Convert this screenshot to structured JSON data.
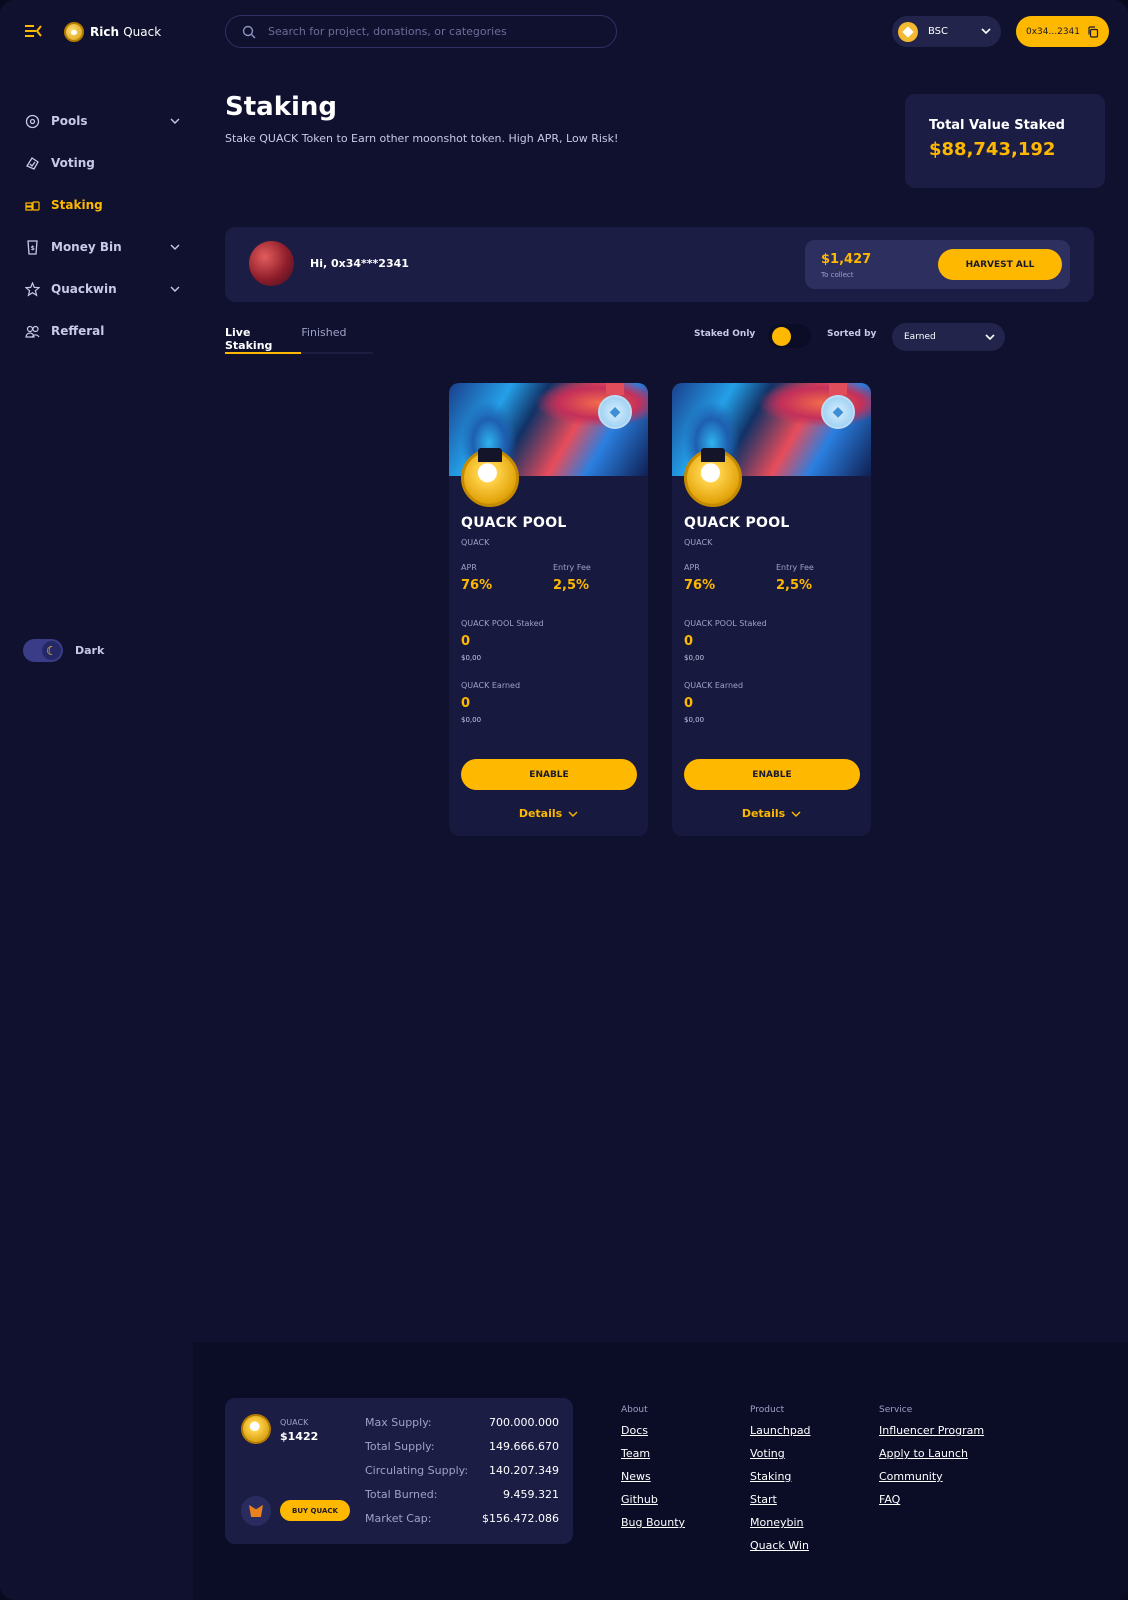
{
  "app": {
    "logo_bold": "Rich",
    "logo_light": "Quack"
  },
  "search": {
    "placeholder": "Search for project, donations, or categories"
  },
  "chain": {
    "label": "BSC"
  },
  "wallet": {
    "label": "0x34...2341"
  },
  "sidebar": {
    "items": [
      {
        "label": "Pools",
        "icon": "pools-icon",
        "has_chevron": true
      },
      {
        "label": "Voting",
        "icon": "voting-icon",
        "has_chevron": false
      },
      {
        "label": "Staking",
        "icon": "staking-icon",
        "has_chevron": false,
        "active": true
      },
      {
        "label": "Money Bin",
        "icon": "money-bin-icon",
        "has_chevron": true
      },
      {
        "label": "Quackwin",
        "icon": "quackwin-icon",
        "has_chevron": true
      },
      {
        "label": "Refferal",
        "icon": "referral-icon",
        "has_chevron": false
      }
    ],
    "theme_label": "Dark"
  },
  "header": {
    "title": "Staking",
    "subtitle": "Stake QUACK Token to Earn other moonshot token. High APR, Low Risk!"
  },
  "tvs": {
    "label": "Total Value Staked",
    "value": "$88,743,192"
  },
  "greeting": {
    "text": "Hi, 0x34***2341",
    "collect_value": "$1,427",
    "collect_label": "To collect",
    "harvest_label": "HARVEST ALL"
  },
  "tabs": [
    {
      "label": "Live Staking",
      "active": true
    },
    {
      "label": "Finished",
      "active": false
    }
  ],
  "filters": {
    "staked_only_label": "Staked Only",
    "staked_only_on": true,
    "sorted_by_label": "Sorted by",
    "sorted_by_value": "Earned"
  },
  "cards": [
    {
      "title": "QUACK POOL",
      "symbol": "QUACK",
      "apr_label": "APR",
      "apr": "76%",
      "fee_label": "Entry Fee",
      "fee": "2,5%",
      "staked_label": "QUACK POOL Staked",
      "staked": "0",
      "staked_usd": "$0,00",
      "earned_label": "QUACK Earned",
      "earned": "0",
      "earned_usd": "$0,00",
      "enable_label": "ENABLE",
      "details_label": "Details"
    },
    {
      "title": "QUACK POOL",
      "symbol": "QUACK",
      "apr_label": "APR",
      "apr": "76%",
      "fee_label": "Entry Fee",
      "fee": "2,5%",
      "staked_label": "QUACK POOL Staked",
      "staked": "0",
      "staked_usd": "$0,00",
      "earned_label": "QUACK Earned",
      "earned": "0",
      "earned_usd": "$0,00",
      "enable_label": "ENABLE",
      "details_label": "Details"
    }
  ],
  "footer": {
    "token_symbol": "QUACK",
    "token_price": "$1422",
    "buy_label": "BUY QUACK",
    "stats": [
      {
        "label": "Max Supply:",
        "value": "700.000.000"
      },
      {
        "label": "Total Supply:",
        "value": "149.666.670"
      },
      {
        "label": "Circulating Supply:",
        "value": "140.207.349"
      },
      {
        "label": "Total Burned:",
        "value": "9.459.321"
      },
      {
        "label": "Market Cap:",
        "value": "$156.472.086"
      }
    ],
    "columns": [
      {
        "title": "About",
        "links": [
          "Docs",
          "Team",
          "News",
          "Github",
          "Bug Bounty"
        ]
      },
      {
        "title": "Product",
        "links": [
          "Launchpad",
          "Voting",
          "Staking",
          "Start",
          "Moneybin",
          "Quack Win"
        ]
      },
      {
        "title": "Service",
        "links": [
          "Influencer Program",
          "Apply to Launch",
          "Community",
          "FAQ"
        ]
      }
    ]
  },
  "colors": {
    "accent": "#ffb800",
    "background": "#10112f",
    "panel": "#1b1d45"
  }
}
